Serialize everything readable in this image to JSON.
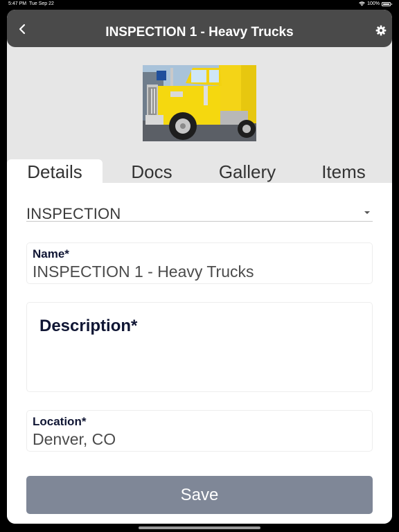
{
  "status": {
    "time": "5:47 PM",
    "date": "Tue Sep 22",
    "battery": "100%",
    "wifi_icon": "wifi-icon",
    "battery_icon": "battery-icon"
  },
  "header": {
    "title": "INSPECTION 1 - Heavy Trucks",
    "back_icon": "chevron-left-icon",
    "settings_icon": "gear-icon",
    "background": "#4a4a4a"
  },
  "tabs": [
    {
      "label": "Details",
      "active": true
    },
    {
      "label": "Docs",
      "active": false
    },
    {
      "label": "Gallery",
      "active": false
    },
    {
      "label": "Items",
      "active": false
    }
  ],
  "form": {
    "type_select": {
      "value": "INSPECTION"
    },
    "name": {
      "label": "Name*",
      "value": "INSPECTION 1 - Heavy Trucks"
    },
    "description": {
      "label": "Description*",
      "value": ""
    },
    "location": {
      "label": "Location*",
      "value": "Denver, CO"
    },
    "save_label": "Save"
  },
  "colors": {
    "save_button": "#7f8797",
    "label_text": "#101634",
    "panel_background": "#e6e6e6"
  }
}
